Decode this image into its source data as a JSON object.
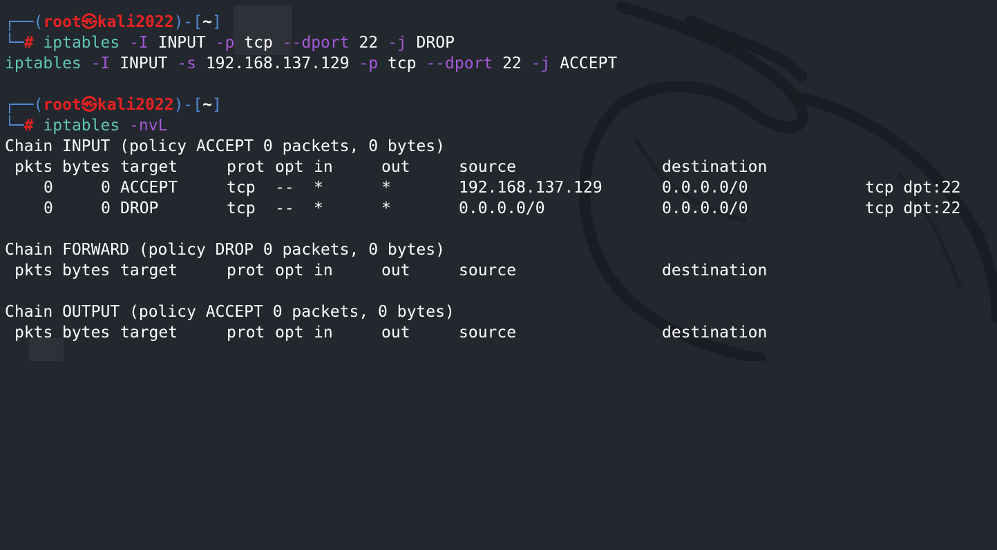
{
  "prompt": {
    "open": "┌──(",
    "user": "root",
    "at": "㉿",
    "host": "kali2022",
    "close": ")-[",
    "dir": "~",
    "end": "]",
    "arrow": "└─",
    "hash": "#"
  },
  "commands": [
    {
      "exe": "iptables",
      "parts": [
        " ",
        "-I",
        " INPUT ",
        "-p",
        " tcp ",
        "--dport",
        " 22 ",
        "-j",
        " DROP"
      ]
    },
    {
      "exe": "iptables",
      "parts": [
        " ",
        "-I",
        " INPUT ",
        "-s",
        " 192.168.137.129 ",
        "-p",
        " tcp ",
        "--dport",
        " 22 ",
        "-j",
        " ACCEPT"
      ]
    },
    {
      "exe": "iptables",
      "parts": [
        " ",
        "-nvL"
      ]
    }
  ],
  "columns": [
    "pkts",
    "bytes",
    "target",
    "prot",
    "opt",
    "in",
    "out",
    "source",
    "destination"
  ],
  "chains": [
    {
      "header": "Chain INPUT (policy ACCEPT 0 packets, 0 bytes)",
      "rules": [
        {
          "pkts": "0",
          "bytes": "0",
          "target": "ACCEPT",
          "prot": "tcp",
          "opt": "--",
          "in": "*",
          "out": "*",
          "source": "192.168.137.129",
          "destination": "0.0.0.0/0",
          "extra": "tcp dpt:22"
        },
        {
          "pkts": "0",
          "bytes": "0",
          "target": "DROP",
          "prot": "tcp",
          "opt": "--",
          "in": "*",
          "out": "*",
          "source": "0.0.0.0/0",
          "destination": "0.0.0.0/0",
          "extra": "tcp dpt:22"
        }
      ]
    },
    {
      "header": "Chain FORWARD (policy DROP 0 packets, 0 bytes)",
      "rules": []
    },
    {
      "header": "Chain OUTPUT (policy ACCEPT 0 packets, 0 bytes)",
      "rules": []
    }
  ]
}
